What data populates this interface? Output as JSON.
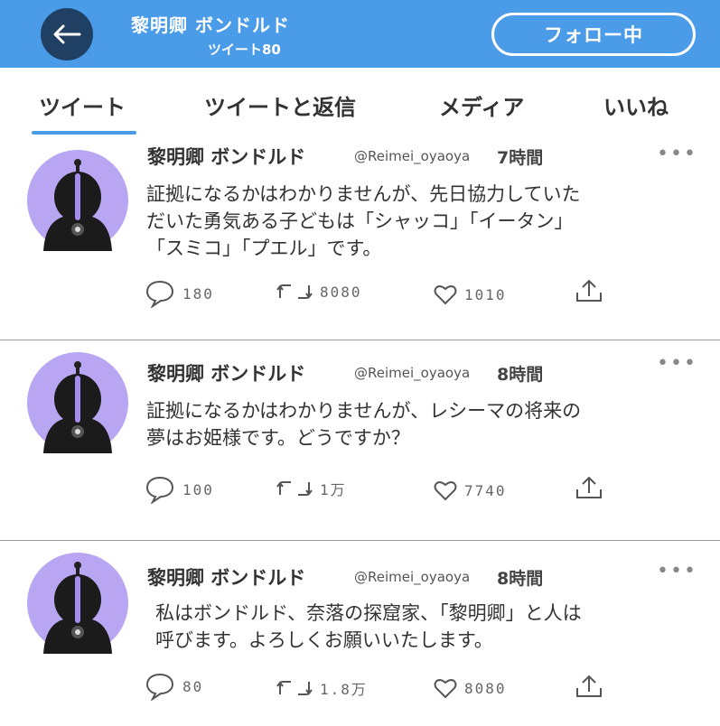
{
  "header": {
    "title": "黎明卿 ボンドルド",
    "subtitle": "ツイート80",
    "follow_label": "フォロー中"
  },
  "tabs": [
    {
      "label": "ツイート"
    },
    {
      "label": "ツイートと返信"
    },
    {
      "label": "メディア"
    },
    {
      "label": "いいね"
    }
  ],
  "tweets": [
    {
      "name": "黎明卿 ボンドルド",
      "handle": "@Reimei_oyaoya",
      "time": "7時間",
      "lines": [
        "証拠になるかはわかりませんが、先日協力していた",
        "だいた勇気ある子どもは「シャッコ」「イータン」",
        "「スミコ」「プエル」です。"
      ],
      "replies": "180",
      "retweets": "8080",
      "likes": "1010"
    },
    {
      "name": "黎明卿 ボンドルド",
      "handle": "@Reimei_oyaoya",
      "time": "8時間",
      "lines": [
        "証拠になるかはわかりませんが、レシーマの将来の",
        "夢はお姫様です。どうですか？"
      ],
      "replies": "100",
      "retweets": "1万",
      "likes": "7740"
    },
    {
      "name": "黎明卿 ボンドルド",
      "handle": "@Reimei_oyaoya",
      "time": "8時間",
      "lines": [
        "私はボンドルド、奈落の探窟家、「黎明卿」と人は",
        "呼びます。よろしくお願いいたします。"
      ],
      "replies": "80",
      "retweets": "1.8万",
      "likes": "8080"
    }
  ],
  "colors": {
    "header_bg": "#4a9be8",
    "back_button_bg": "#1f3f63",
    "avatar_bg": "#b8a6f2",
    "accent_purple": "#a48cf0"
  },
  "icons": {
    "back": "arrow-left-icon",
    "more": "more-dots-icon",
    "reply": "speech-bubble-icon",
    "retweet": "retweet-arrows-icon",
    "like": "heart-icon",
    "share": "share-upload-icon"
  }
}
